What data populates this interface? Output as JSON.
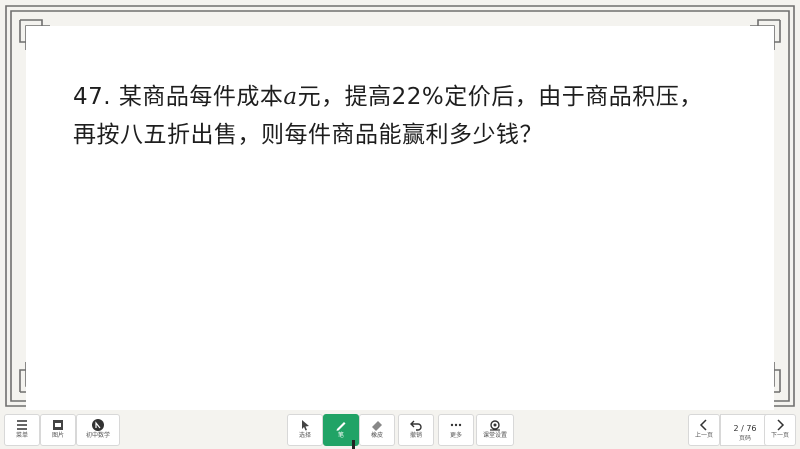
{
  "question": {
    "prefix": "47. 某商品每件成本",
    "variable": "a",
    "suffix": "元，提高22%定价后，由于商品积压，",
    "line2": "再按八五折出售，则每件商品能赢利多少钱？"
  },
  "toolbar": {
    "left": [
      {
        "icon": "menu-icon",
        "label": "菜单"
      },
      {
        "icon": "gallery-icon",
        "label": "图片"
      },
      {
        "icon": "app-icon",
        "label": "初中数学"
      }
    ],
    "center": [
      {
        "icon": "pointer-icon",
        "label": "选择"
      },
      {
        "icon": "pen-icon",
        "label": "笔",
        "active": true
      },
      {
        "icon": "eraser-icon",
        "label": "橡皮"
      },
      {
        "icon": "undo-icon",
        "label": "撤销"
      },
      {
        "icon": "more-icon",
        "label": "更多"
      },
      {
        "icon": "settings-icon",
        "label": "课堂设置"
      }
    ],
    "right": {
      "prev_label": "上一页",
      "page_number": "2 / 76",
      "page_label": "页码",
      "next_label": "下一页"
    }
  },
  "colors": {
    "accent": "#21a366",
    "frame": "#7a7a7a",
    "board": "#ffffff"
  }
}
